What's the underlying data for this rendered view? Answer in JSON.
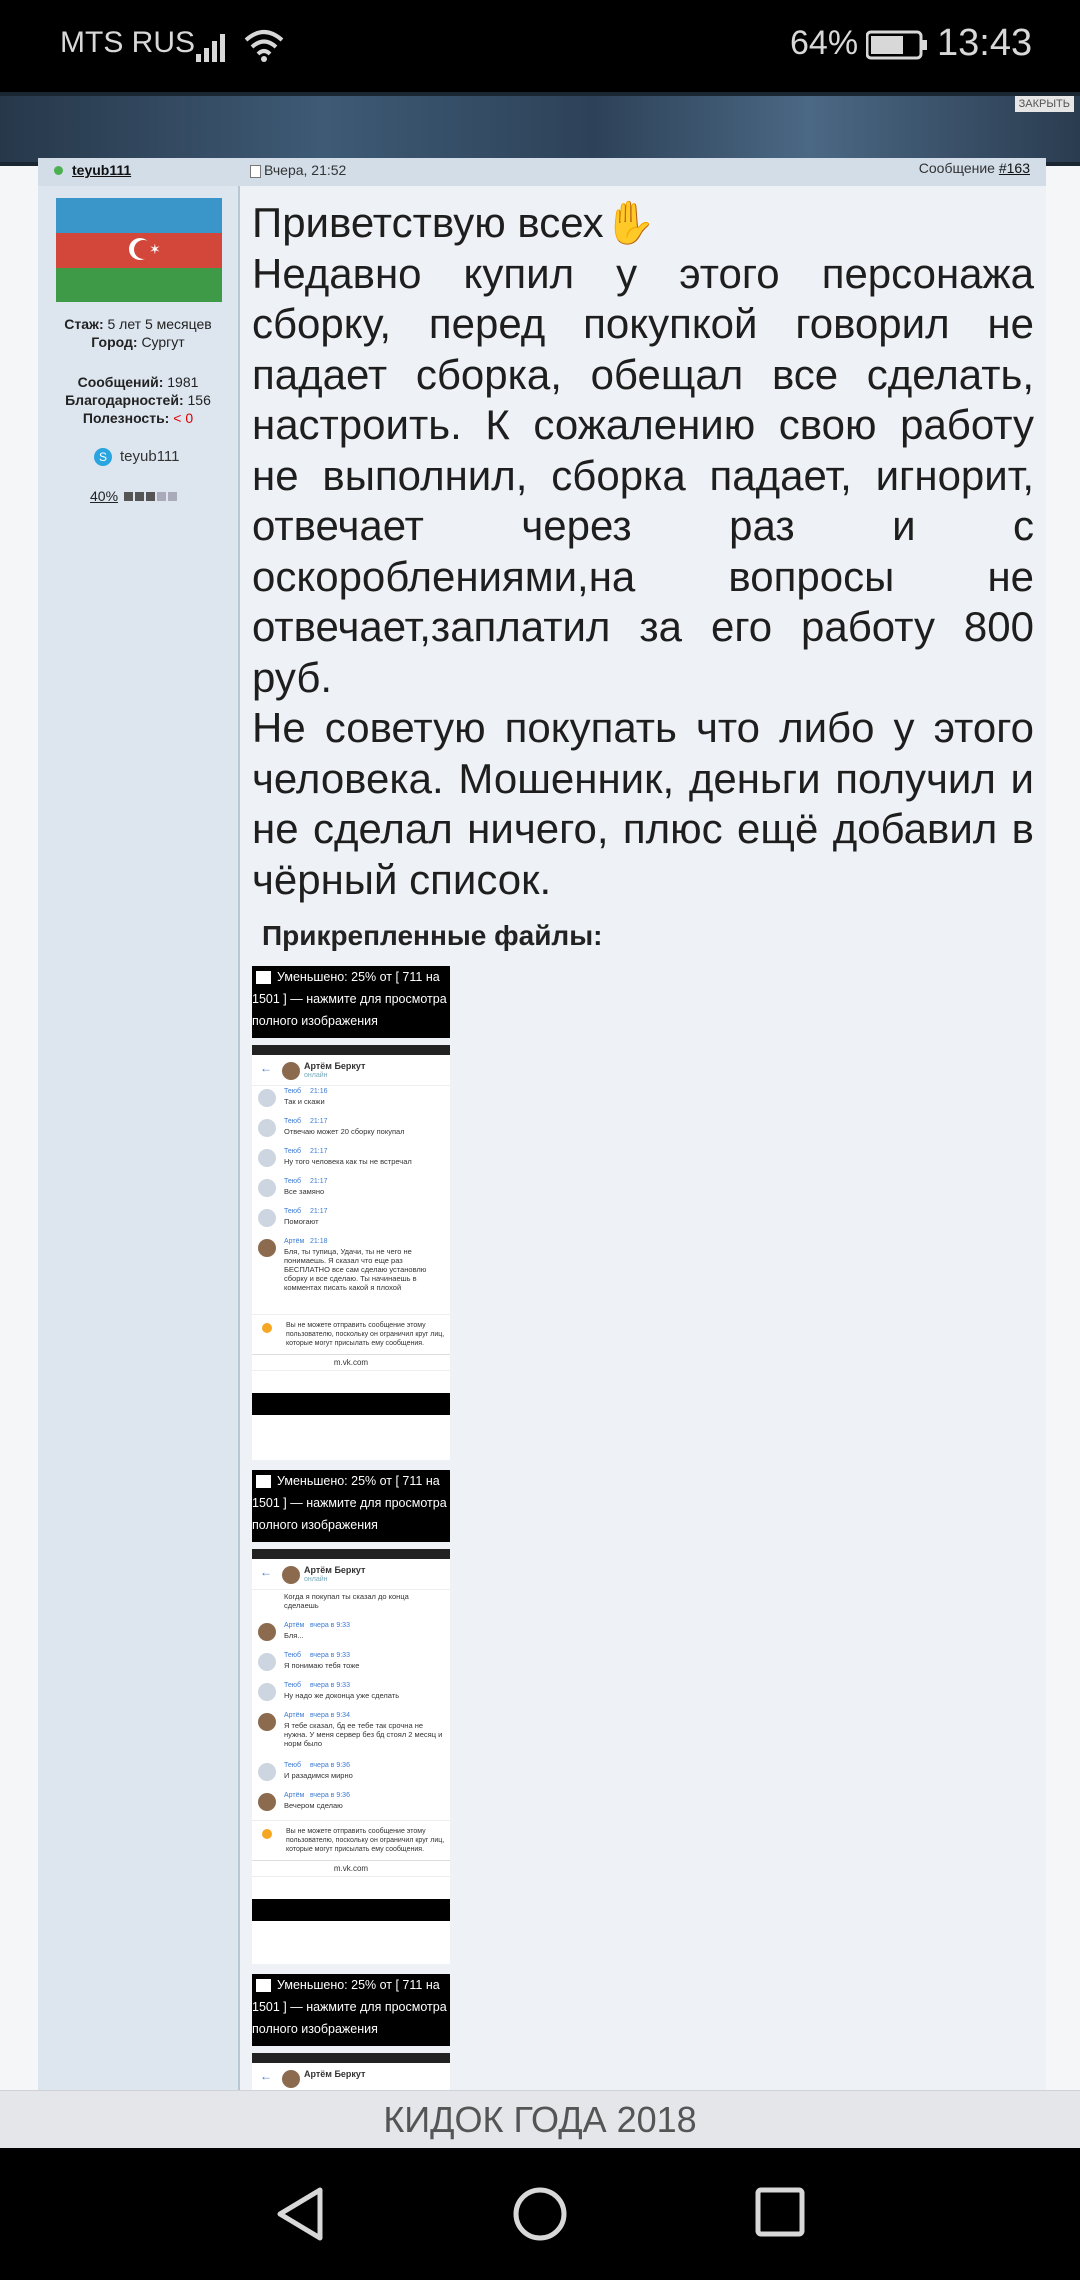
{
  "status_bar": {
    "carrier": "MTS RUS",
    "battery": "64%",
    "time": "13:43"
  },
  "banner": {
    "close_label": "ЗАКРЫТЬ"
  },
  "post": {
    "username": "teyub111",
    "date": "Вчера, 21:52",
    "message_label": "Сообщение",
    "message_number": "#163",
    "stats": {
      "stazh_label": "Стаж:",
      "stazh_value": "5 лет 5 месяцев",
      "city_label": "Город:",
      "city_value": "Сургут",
      "posts_label": "Сообщений:",
      "posts_value": "1981",
      "thanks_label": "Благодарностей:",
      "thanks_value": "156",
      "useful_label": "Полезность:",
      "useful_value": "< 0"
    },
    "skype_name": "teyub111",
    "reputation_percent": "40",
    "reputation_suffix": "%",
    "paragraphs": [
      "Приветствую всех✋",
      "Недавно купил у этого персонажа сборку, перед покупкой говорил не падает сборка, обещал все сделать, настроить. К сожалению свою работу не выполнил, сборка падает, игнорит, отвечает через раз и с оскороблениями,на вопросы не отвечает,заплатил за его работу 800 руб.",
      "Не советую покупать что либо у этого человека. Мошенник, деньги получил и не сделал ничего, плюс ещё добавил в чёрный список."
    ],
    "attachments_title": "Прикрепленные файлы:",
    "thumb_caption": "Уменьшено: 25% от [ 711 на 1501 ] — нажмите для просмотра полного изображения",
    "screenshot1": {
      "contact": "Артём Беркут",
      "status": "онлайн",
      "messages": [
        {
          "author": "Теюб",
          "time": "21:16",
          "text": "Так и скажи"
        },
        {
          "author": "Теюб",
          "time": "21:17",
          "text": "Отвечаю может 20 сборку покупал"
        },
        {
          "author": "Теюб",
          "time": "21:17",
          "text": "Ну того человека как ты не встречал"
        },
        {
          "author": "Теюб",
          "time": "21:17",
          "text": "Все замяно"
        },
        {
          "author": "Теюб",
          "time": "21:17",
          "text": "Помогают"
        },
        {
          "author": "Артём",
          "time": "21:18",
          "text": "Бля, ты тупица, Удачи, ты не чего не понимаешь. Я сказал что еще раз БЕСПЛАТНО все сам сделаю установлю сборку и все сделаю. Ты начинаешь в комментах писать какой я плохой"
        }
      ],
      "warning": "Вы не можете отправить сообщение этому пользователю, поскольку он ограничил круг лиц, которые могут присылать ему сообщения.",
      "url": "m.vk.com"
    },
    "screenshot2": {
      "contact": "Артём Беркут",
      "status": "онлайн",
      "messages": [
        {
          "author": "",
          "time": "",
          "text": "Когда я покупал ты сказал до конца сделаешь"
        },
        {
          "author": "Артём",
          "time": "вчера в 9:33",
          "text": "Бля..."
        },
        {
          "author": "Теюб",
          "time": "вчера в 9:33",
          "text": "Я понимаю тебя тоже"
        },
        {
          "author": "Теюб",
          "time": "вчера в 9:33",
          "text": "Ну надо же доконца уже сделать"
        },
        {
          "author": "Артём",
          "time": "вчера в 9:34",
          "text": "Я тебе сказал, бд ее тебе так срочна не нужна. У меня сервер без бд стоял 2 месяц и норм было"
        },
        {
          "author": "Теюб",
          "time": "вчера в 9:36",
          "text": "И разадимся мирно"
        },
        {
          "author": "Артём",
          "time": "вчера в 9:36",
          "text": "Вечером сделаю"
        }
      ],
      "warning": "Вы не можете отправить сообщение этому пользователю, поскольку он ограничил круг лиц, которые могут присылать ему сообщения.",
      "url": "m.vk.com"
    },
    "screenshot3": {
      "contact": "Артём Беркут"
    }
  },
  "footer_title": "КИДОК ГОДА 2018"
}
